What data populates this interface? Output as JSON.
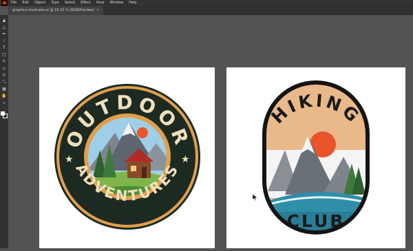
{
  "menu": {
    "app_icon": "Ai",
    "items": [
      "File",
      "Edit",
      "Object",
      "Type",
      "Select",
      "Effect",
      "View",
      "Window",
      "Help"
    ]
  },
  "document_tab": {
    "label": "graphics-illustrator.ai @ 16.15 % (RGB/Preview)",
    "close_glyph": "×"
  },
  "badges": {
    "outdoor": {
      "top_text": "OUTDOOR",
      "bottom_text": "ADVENTURES"
    },
    "hiking": {
      "top_text": "HIKING",
      "bottom_text": "CLUB"
    }
  },
  "colors": {
    "workspace": "#535353",
    "chrome": "#323232",
    "badge_dark": "#1d2a22",
    "badge_orange": "#e0a04e",
    "badge_cream": "#efe0bc",
    "sky_blue": "#9fcfe8",
    "sun_orange": "#e8552a",
    "water_teal": "#2f8ea8",
    "forest_green": "#3f7a3a"
  },
  "icons": [
    "selection-tool-icon",
    "direct-selection-tool-icon",
    "pen-tool-icon",
    "brush-tool-icon",
    "type-tool-icon",
    "rectangle-tool-icon",
    "pencil-tool-icon",
    "eraser-tool-icon",
    "rotate-tool-icon",
    "scale-tool-icon",
    "gradient-tool-icon",
    "hand-tool-icon",
    "zoom-tool-icon",
    "arrow-cursor-icon"
  ]
}
